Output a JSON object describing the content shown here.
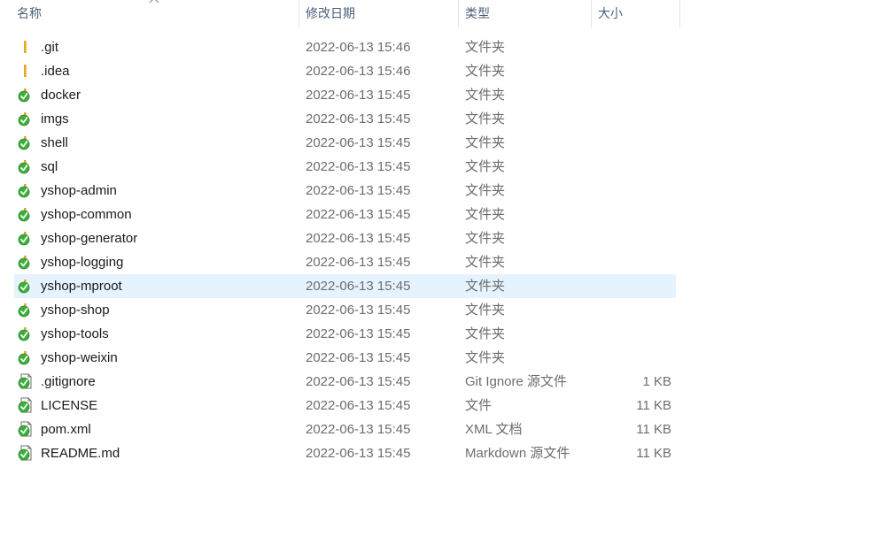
{
  "columns": {
    "name": "名称",
    "modified": "修改日期",
    "type": "类型",
    "size": "大小"
  },
  "colors": {
    "selected_bg": "#e5f3ff",
    "folder": "#f5c34d",
    "check_green": "#3cae3a",
    "header_text": "#4c607a"
  },
  "files": [
    {
      "name": ".git",
      "modified": "2022-06-13 15:46",
      "type": "文件夹",
      "size": "",
      "icon": "folder-icon"
    },
    {
      "name": ".idea",
      "modified": "2022-06-13 15:46",
      "type": "文件夹",
      "size": "",
      "icon": "folder-icon"
    },
    {
      "name": "docker",
      "modified": "2022-06-13 15:45",
      "type": "文件夹",
      "size": "",
      "icon": "folder-synced-icon"
    },
    {
      "name": "imgs",
      "modified": "2022-06-13 15:45",
      "type": "文件夹",
      "size": "",
      "icon": "folder-synced-icon"
    },
    {
      "name": "shell",
      "modified": "2022-06-13 15:45",
      "type": "文件夹",
      "size": "",
      "icon": "folder-synced-icon"
    },
    {
      "name": "sql",
      "modified": "2022-06-13 15:45",
      "type": "文件夹",
      "size": "",
      "icon": "folder-synced-icon"
    },
    {
      "name": "yshop-admin",
      "modified": "2022-06-13 15:45",
      "type": "文件夹",
      "size": "",
      "icon": "folder-synced-icon"
    },
    {
      "name": "yshop-common",
      "modified": "2022-06-13 15:45",
      "type": "文件夹",
      "size": "",
      "icon": "folder-synced-icon"
    },
    {
      "name": "yshop-generator",
      "modified": "2022-06-13 15:45",
      "type": "文件夹",
      "size": "",
      "icon": "folder-synced-icon"
    },
    {
      "name": "yshop-logging",
      "modified": "2022-06-13 15:45",
      "type": "文件夹",
      "size": "",
      "icon": "folder-synced-icon"
    },
    {
      "name": "yshop-mproot",
      "modified": "2022-06-13 15:45",
      "type": "文件夹",
      "size": "",
      "icon": "folder-synced-icon",
      "selected": true
    },
    {
      "name": "yshop-shop",
      "modified": "2022-06-13 15:45",
      "type": "文件夹",
      "size": "",
      "icon": "folder-synced-icon"
    },
    {
      "name": "yshop-tools",
      "modified": "2022-06-13 15:45",
      "type": "文件夹",
      "size": "",
      "icon": "folder-synced-icon"
    },
    {
      "name": "yshop-weixin",
      "modified": "2022-06-13 15:45",
      "type": "文件夹",
      "size": "",
      "icon": "folder-synced-icon"
    },
    {
      "name": ".gitignore",
      "modified": "2022-06-13 15:45",
      "type": "Git Ignore 源文件",
      "size": "1 KB",
      "icon": "file-synced-icon"
    },
    {
      "name": "LICENSE",
      "modified": "2022-06-13 15:45",
      "type": "文件",
      "size": "11 KB",
      "icon": "file-synced-icon"
    },
    {
      "name": "pom.xml",
      "modified": "2022-06-13 15:45",
      "type": "XML 文档",
      "size": "11 KB",
      "icon": "file-synced-icon"
    },
    {
      "name": "README.md",
      "modified": "2022-06-13 15:45",
      "type": "Markdown 源文件",
      "size": "11 KB",
      "icon": "file-synced-icon"
    }
  ]
}
